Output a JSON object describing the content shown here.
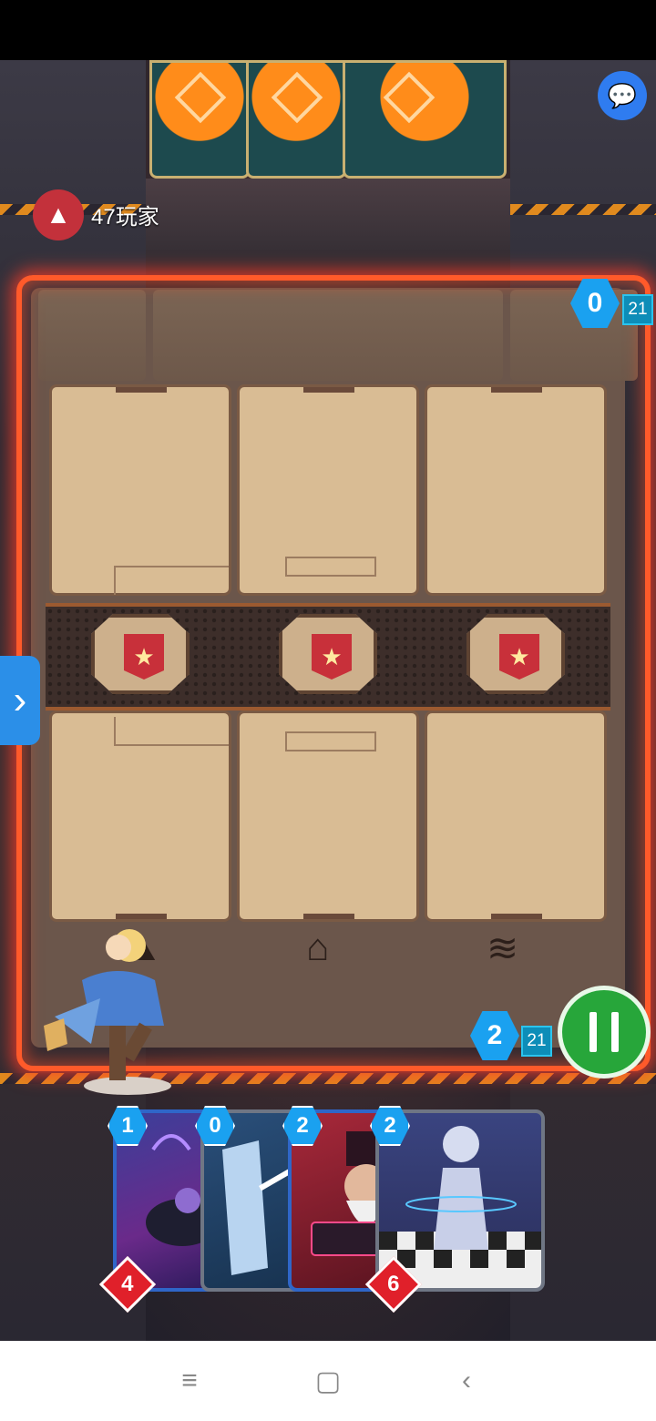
{
  "top_bar": {
    "player_count": "47玩家"
  },
  "opponent": {
    "power": "0",
    "deck_count": "21"
  },
  "player": {
    "power": "2",
    "deck_count": "21"
  },
  "hand": [
    {
      "cost": "1",
      "power": "4",
      "art": "purple-vacuum-robot"
    },
    {
      "cost": "0",
      "power": "",
      "art": "tablet-stylus"
    },
    {
      "cost": "2",
      "power": "",
      "art": "top-hat-magician"
    },
    {
      "cost": "2",
      "power": "6",
      "art": "chess-pawn-robot"
    }
  ],
  "locations": [
    {
      "icon": "mountain-icon"
    },
    {
      "icon": "house-icon"
    },
    {
      "icon": "waves-icon"
    }
  ],
  "colors": {
    "frame_glow": "#ff5a2a",
    "energy_blue": "#1aa1f0",
    "end_turn_green": "#27a63a",
    "power_red": "#e0202a"
  },
  "icons": {
    "chat": "chat-bubble-icon",
    "side_tab": "chevron-right-icon",
    "end_turn": "pause-bars-icon",
    "nav": [
      "menu-icon",
      "home-square-icon",
      "back-chevron-icon"
    ]
  }
}
